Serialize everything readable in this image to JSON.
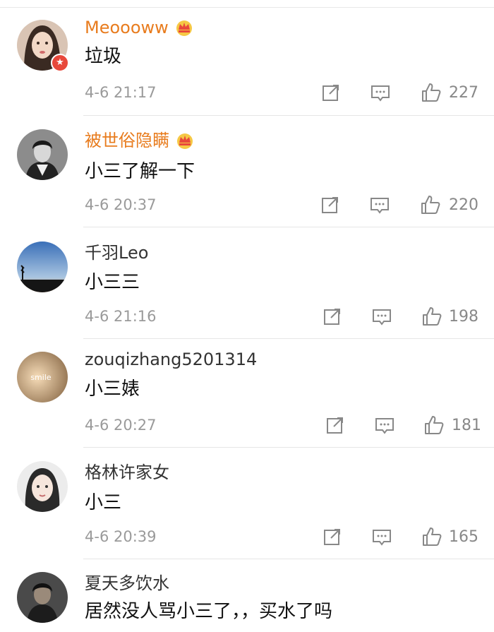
{
  "comments": [
    {
      "user": "Meoooww",
      "vip": true,
      "text": "垃圾",
      "time": "4-6 21:17",
      "likes": "227"
    },
    {
      "user": "被世俗隐瞒",
      "vip": true,
      "text": "小三了解一下",
      "time": "4-6 20:37",
      "likes": "220"
    },
    {
      "user": "千羽Leo",
      "vip": false,
      "text": "小三三",
      "time": "4-6 21:16",
      "likes": "198"
    },
    {
      "user": "zouqizhang5201314",
      "vip": false,
      "text": "小三婊",
      "time": "4-6 20:27",
      "likes": "181",
      "avatar_text": "smile"
    },
    {
      "user": "格林许家女",
      "vip": false,
      "text": "小三",
      "time": "4-6 20:39",
      "likes": "165"
    },
    {
      "user": "夏天多饮水",
      "vip": false,
      "text": "居然没人骂小三了，，买水了吗"
    }
  ],
  "icons": {
    "share": "share-icon",
    "reply": "comment-icon",
    "like": "thumbs-up-icon",
    "crown": "crown-icon",
    "star_badge": "star-badge-icon"
  },
  "colors": {
    "vip_name": "#e87c1e",
    "normal_name": "#333333",
    "meta": "#9a9a9a",
    "divider": "#e6e6e6",
    "badge": "#e8483b"
  }
}
